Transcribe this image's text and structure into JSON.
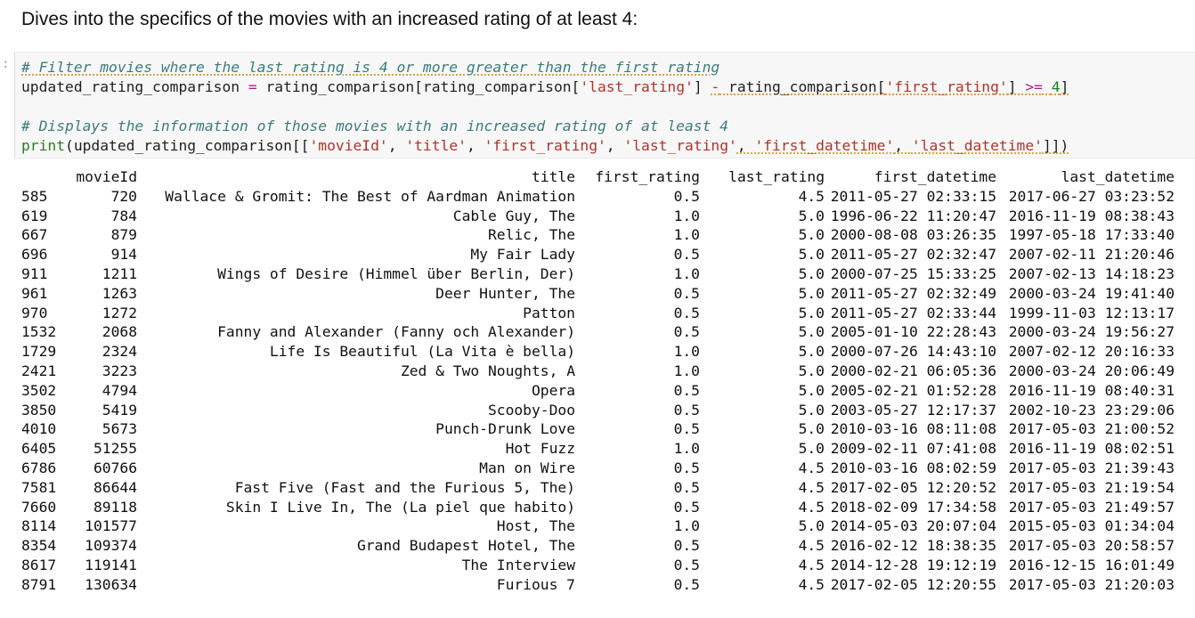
{
  "heading": "Dives into the specifics of the movies with an increased rating of at least 4:",
  "prompt_marker": ":",
  "code": {
    "line1_comment": "# Filter movies where the last rating is 4 or more greater than the first rating",
    "line2": {
      "var": "updated_rating_comparison",
      "eq": " = ",
      "obj1": "rating_comparison[rating_comparison[",
      "str1": "'last_rating'",
      "close1": "] ",
      "minus": "-",
      "obj2": " rating_comparison[",
      "str2": "'first_rating'",
      "close2": "] ",
      "ge": ">=",
      "space": " ",
      "num": "4",
      "close3": "]"
    },
    "line4_comment": "# Displays the information of those movies with an increased rating of at least 4",
    "line5": {
      "fn": "print",
      "open": "(updated_rating_comparison[[",
      "s1": "'movieId'",
      "c1": ", ",
      "s2": "'title'",
      "c2": ", ",
      "s3": "'first_rating'",
      "c3": ", ",
      "s4": "'last_rating'",
      "c4": ", ",
      "s5": "'first_datetime'",
      "c5": ", ",
      "s6": "'last_datetime'",
      "close": "]])"
    }
  },
  "output": {
    "columns": {
      "movieId": "movieId",
      "title": "title",
      "first_rating": "first_rating",
      "last_rating": "last_rating",
      "first_datetime": "first_datetime",
      "last_datetime": "last_datetime"
    },
    "rows": [
      {
        "idx": "585",
        "movieId": "720",
        "title": "Wallace & Gromit: The Best of Aardman Animation",
        "first_rating": "0.5",
        "last_rating": "4.5",
        "first_datetime": "2011-05-27 02:33:15",
        "last_datetime": "2017-06-27 03:23:52"
      },
      {
        "idx": "619",
        "movieId": "784",
        "title": "Cable Guy, The",
        "first_rating": "1.0",
        "last_rating": "5.0",
        "first_datetime": "1996-06-22 11:20:47",
        "last_datetime": "2016-11-19 08:38:43"
      },
      {
        "idx": "667",
        "movieId": "879",
        "title": "Relic, The",
        "first_rating": "1.0",
        "last_rating": "5.0",
        "first_datetime": "2000-08-08 03:26:35",
        "last_datetime": "1997-05-18 17:33:40"
      },
      {
        "idx": "696",
        "movieId": "914",
        "title": "My Fair Lady",
        "first_rating": "0.5",
        "last_rating": "5.0",
        "first_datetime": "2011-05-27 02:32:47",
        "last_datetime": "2007-02-11 21:20:46"
      },
      {
        "idx": "911",
        "movieId": "1211",
        "title": "Wings of Desire (Himmel über Berlin, Der)",
        "first_rating": "1.0",
        "last_rating": "5.0",
        "first_datetime": "2000-07-25 15:33:25",
        "last_datetime": "2007-02-13 14:18:23"
      },
      {
        "idx": "961",
        "movieId": "1263",
        "title": "Deer Hunter, The",
        "first_rating": "0.5",
        "last_rating": "5.0",
        "first_datetime": "2011-05-27 02:32:49",
        "last_datetime": "2000-03-24 19:41:40"
      },
      {
        "idx": "970",
        "movieId": "1272",
        "title": "Patton",
        "first_rating": "0.5",
        "last_rating": "5.0",
        "first_datetime": "2011-05-27 02:33:44",
        "last_datetime": "1999-11-03 12:13:17"
      },
      {
        "idx": "1532",
        "movieId": "2068",
        "title": "Fanny and Alexander (Fanny och Alexander)",
        "first_rating": "0.5",
        "last_rating": "5.0",
        "first_datetime": "2005-01-10 22:28:43",
        "last_datetime": "2000-03-24 19:56:27"
      },
      {
        "idx": "1729",
        "movieId": "2324",
        "title": "Life Is Beautiful (La Vita è bella)",
        "first_rating": "1.0",
        "last_rating": "5.0",
        "first_datetime": "2000-07-26 14:43:10",
        "last_datetime": "2007-02-12 20:16:33"
      },
      {
        "idx": "2421",
        "movieId": "3223",
        "title": "Zed & Two Noughts, A",
        "first_rating": "1.0",
        "last_rating": "5.0",
        "first_datetime": "2000-02-21 06:05:36",
        "last_datetime": "2000-03-24 20:06:49"
      },
      {
        "idx": "3502",
        "movieId": "4794",
        "title": "Opera",
        "first_rating": "0.5",
        "last_rating": "5.0",
        "first_datetime": "2005-02-21 01:52:28",
        "last_datetime": "2016-11-19 08:40:31"
      },
      {
        "idx": "3850",
        "movieId": "5419",
        "title": "Scooby-Doo",
        "first_rating": "0.5",
        "last_rating": "5.0",
        "first_datetime": "2003-05-27 12:17:37",
        "last_datetime": "2002-10-23 23:29:06"
      },
      {
        "idx": "4010",
        "movieId": "5673",
        "title": "Punch-Drunk Love",
        "first_rating": "0.5",
        "last_rating": "5.0",
        "first_datetime": "2010-03-16 08:11:08",
        "last_datetime": "2017-05-03 21:00:52"
      },
      {
        "idx": "6405",
        "movieId": "51255",
        "title": "Hot Fuzz",
        "first_rating": "1.0",
        "last_rating": "5.0",
        "first_datetime": "2009-02-11 07:41:08",
        "last_datetime": "2016-11-19 08:02:51"
      },
      {
        "idx": "6786",
        "movieId": "60766",
        "title": "Man on Wire",
        "first_rating": "0.5",
        "last_rating": "4.5",
        "first_datetime": "2010-03-16 08:02:59",
        "last_datetime": "2017-05-03 21:39:43"
      },
      {
        "idx": "7581",
        "movieId": "86644",
        "title": "Fast Five (Fast and the Furious 5, The)",
        "first_rating": "0.5",
        "last_rating": "4.5",
        "first_datetime": "2017-02-05 12:20:52",
        "last_datetime": "2017-05-03 21:19:54"
      },
      {
        "idx": "7660",
        "movieId": "89118",
        "title": "Skin I Live In, The (La piel que habito)",
        "first_rating": "0.5",
        "last_rating": "4.5",
        "first_datetime": "2018-02-09 17:34:58",
        "last_datetime": "2017-05-03 21:49:57"
      },
      {
        "idx": "8114",
        "movieId": "101577",
        "title": "Host, The",
        "first_rating": "1.0",
        "last_rating": "5.0",
        "first_datetime": "2014-05-03 20:07:04",
        "last_datetime": "2015-05-03 01:34:04"
      },
      {
        "idx": "8354",
        "movieId": "109374",
        "title": "Grand Budapest Hotel, The",
        "first_rating": "0.5",
        "last_rating": "4.5",
        "first_datetime": "2016-02-12 18:38:35",
        "last_datetime": "2017-05-03 20:58:57"
      },
      {
        "idx": "8617",
        "movieId": "119141",
        "title": "The Interview",
        "first_rating": "0.5",
        "last_rating": "4.5",
        "first_datetime": "2014-12-28 19:12:19",
        "last_datetime": "2016-12-15 16:01:49"
      },
      {
        "idx": "8791",
        "movieId": "130634",
        "title": "Furious 7",
        "first_rating": "0.5",
        "last_rating": "4.5",
        "first_datetime": "2017-02-05 12:20:55",
        "last_datetime": "2017-05-03 21:20:03"
      }
    ]
  }
}
